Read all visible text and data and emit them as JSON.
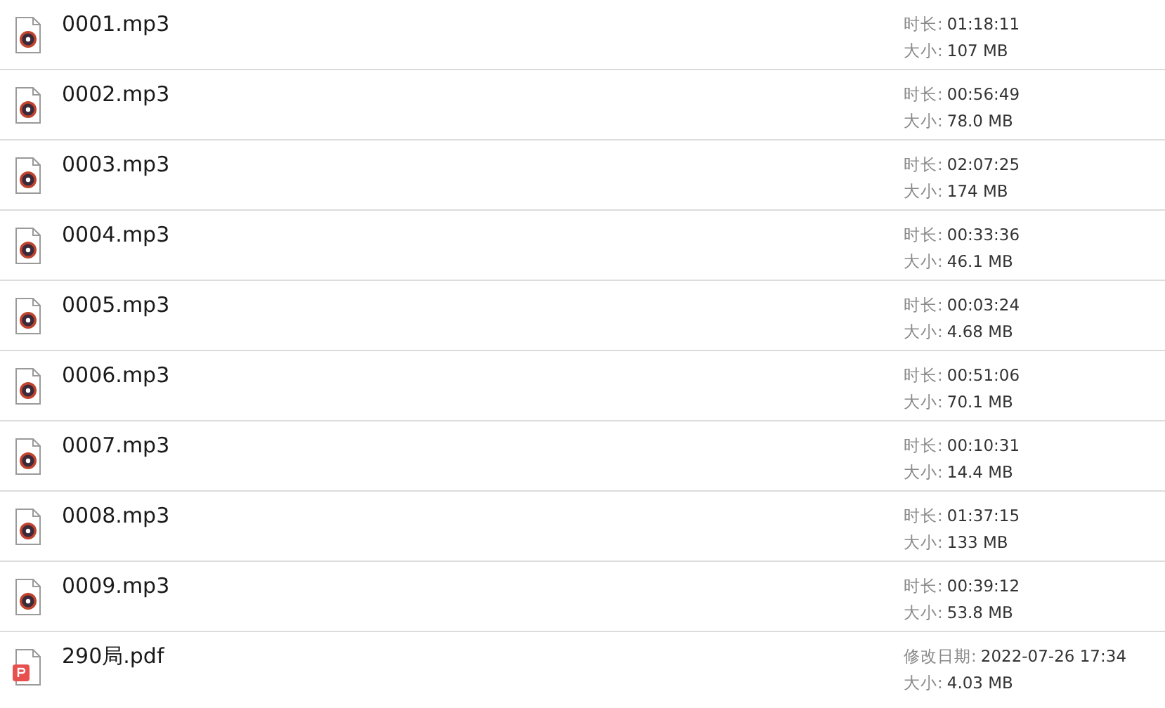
{
  "files": [
    {
      "kind": "audio",
      "name": "0001.mp3",
      "details": [
        {
          "label": "时长:",
          "value": "01:18:11"
        },
        {
          "label": "大小:",
          "value": "107 MB"
        }
      ]
    },
    {
      "kind": "audio",
      "name": "0002.mp3",
      "details": [
        {
          "label": "时长:",
          "value": "00:56:49"
        },
        {
          "label": "大小:",
          "value": "78.0 MB"
        }
      ]
    },
    {
      "kind": "audio",
      "name": "0003.mp3",
      "details": [
        {
          "label": "时长:",
          "value": "02:07:25"
        },
        {
          "label": "大小:",
          "value": "174 MB"
        }
      ]
    },
    {
      "kind": "audio",
      "name": "0004.mp3",
      "details": [
        {
          "label": "时长:",
          "value": "00:33:36"
        },
        {
          "label": "大小:",
          "value": "46.1 MB"
        }
      ]
    },
    {
      "kind": "audio",
      "name": "0005.mp3",
      "details": [
        {
          "label": "时长:",
          "value": "00:03:24"
        },
        {
          "label": "大小:",
          "value": "4.68 MB"
        }
      ]
    },
    {
      "kind": "audio",
      "name": "0006.mp3",
      "details": [
        {
          "label": "时长:",
          "value": "00:51:06"
        },
        {
          "label": "大小:",
          "value": "70.1 MB"
        }
      ]
    },
    {
      "kind": "audio",
      "name": "0007.mp3",
      "details": [
        {
          "label": "时长:",
          "value": "00:10:31"
        },
        {
          "label": "大小:",
          "value": "14.4 MB"
        }
      ]
    },
    {
      "kind": "audio",
      "name": "0008.mp3",
      "details": [
        {
          "label": "时长:",
          "value": "01:37:15"
        },
        {
          "label": "大小:",
          "value": "133 MB"
        }
      ]
    },
    {
      "kind": "audio",
      "name": "0009.mp3",
      "details": [
        {
          "label": "时长:",
          "value": "00:39:12"
        },
        {
          "label": "大小:",
          "value": "53.8 MB"
        }
      ]
    },
    {
      "kind": "pdf",
      "name": "290局.pdf",
      "details": [
        {
          "label": "修改日期:",
          "value": "2022-07-26 17:34"
        },
        {
          "label": "大小:",
          "value": "4.03 MB"
        }
      ]
    }
  ]
}
